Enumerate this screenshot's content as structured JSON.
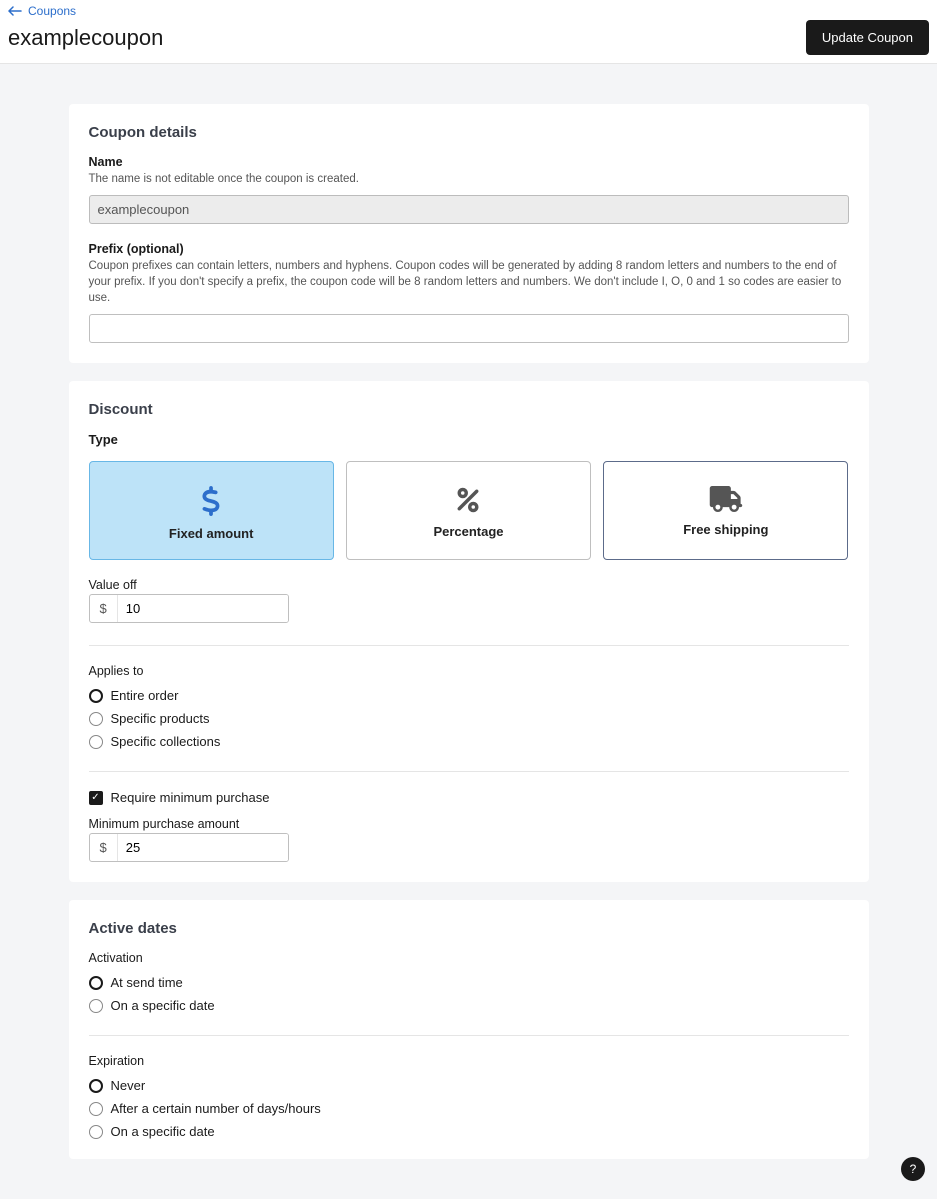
{
  "header": {
    "back_label": "Coupons",
    "page_title": "examplecoupon",
    "update_button": "Update Coupon"
  },
  "details": {
    "card_title": "Coupon details",
    "name_label": "Name",
    "name_help": "The name is not editable once the coupon is created.",
    "name_value": "examplecoupon",
    "prefix_label": "Prefix (optional)",
    "prefix_help": "Coupon prefixes can contain letters, numbers and hyphens. Coupon codes will be generated by adding 8 random letters and numbers to the end of your prefix. If you don't specify a prefix, the coupon code will be 8 random letters and numbers. We don't include I, O, 0 and 1 so codes are easier to use.",
    "prefix_value": ""
  },
  "discount": {
    "card_title": "Discount",
    "type_label": "Type",
    "types": {
      "fixed": "Fixed amount",
      "percentage": "Percentage",
      "free_shipping": "Free shipping"
    },
    "value_off_label": "Value off",
    "currency_symbol": "$",
    "value_off": "10",
    "applies_label": "Applies to",
    "applies_options": {
      "entire": "Entire order",
      "products": "Specific products",
      "collections": "Specific collections"
    },
    "require_min_label": "Require minimum purchase",
    "min_amount_label": "Minimum purchase amount",
    "min_amount": "25"
  },
  "active": {
    "card_title": "Active dates",
    "activation_label": "Activation",
    "activation_options": {
      "send": "At send time",
      "date": "On a specific date"
    },
    "expiration_label": "Expiration",
    "expiration_options": {
      "never": "Never",
      "after": "After a certain number of days/hours",
      "date": "On a specific date"
    }
  },
  "help": {
    "label": "?"
  }
}
